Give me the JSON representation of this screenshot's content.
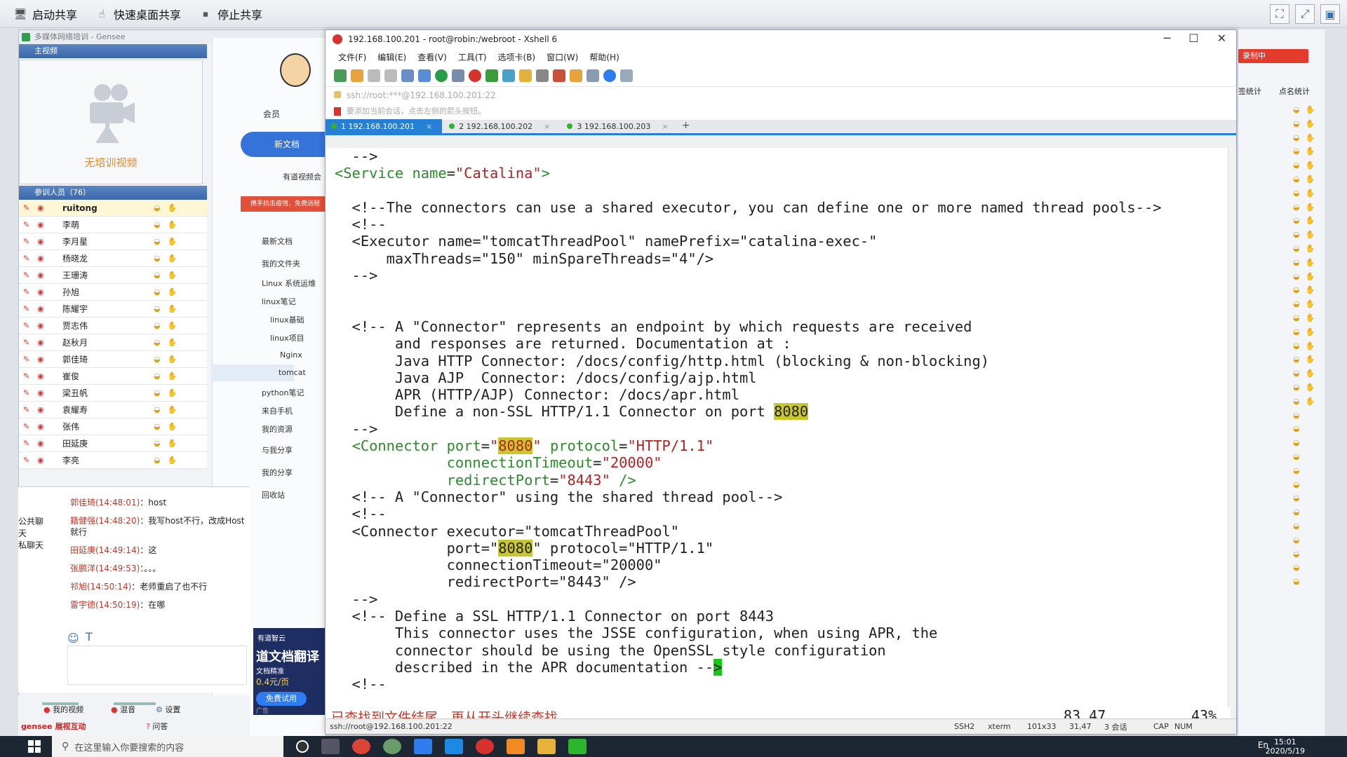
{
  "sharebar": {
    "start_share": "启动共享",
    "quick_desktop_share": "快速桌面共享",
    "stop_share": "停止共享"
  },
  "gensee": {
    "title": "多媒体网络培训 - Gensee",
    "video_panel_title": "主视频",
    "no_video_text": "无培训视频",
    "members_header": "参训人员（76）",
    "members": [
      "ruitong",
      "李萌",
      "李月星",
      "杨晓龙",
      "王珊涛",
      "孙旭",
      "陈耀宇",
      "贾志伟",
      "赵秋月",
      "郭佳琦",
      "崔俊",
      "梁丑帆",
      "袁耀寿",
      "张伟",
      "田延庚",
      "李亮"
    ],
    "chat_tabs": [
      "公共聊天",
      "私聊天"
    ],
    "chat": [
      {
        "who": "郭佳琦(14:48:01)",
        "msg": "host"
      },
      {
        "who": "籍健强(14:48:20)",
        "msg": "我写host不行，改成Host就行"
      },
      {
        "who": "田延庚(14:49:14)",
        "msg": "这"
      },
      {
        "who": "张鹏洋(14:49:53)",
        "msg": "。。。"
      },
      {
        "who": "祁旭(14:50:14)",
        "msg": "老师重启了也不行"
      },
      {
        "who": "雷宇德(14:50:19)",
        "msg": "在哪"
      }
    ],
    "bottom": {
      "my_video": "我的视频",
      "mix": "混音",
      "settings": "设置",
      "qa": "问答",
      "brand": "gensee 展视互动"
    }
  },
  "notes": {
    "member": "会员",
    "new_doc": "新文档",
    "video_meeting": "有道视频会",
    "promo": "携手抗击疫情，免费远程",
    "tree": [
      "最新文档",
      "我的文件夹",
      "Linux 系统运维",
      "linux笔记",
      "linux基础",
      "linux项目",
      "Nginx",
      "tomcat",
      "python笔记",
      "来自手机",
      "我的资源",
      "与我分享",
      "我的分享",
      "回收站"
    ],
    "ad_title": "道文档翻译",
    "ad_sub": "文档精准",
    "ad_price": "0.4元/页",
    "ad_btn": "免费试用",
    "ad_tag": "广告",
    "ad_top": "有道智云"
  },
  "xshell": {
    "title": "192.168.100.201 - root@robin:/webroot - Xshell 6",
    "menu": [
      "文件(F)",
      "编辑(E)",
      "查看(V)",
      "工具(T)",
      "选项卡(B)",
      "窗口(W)",
      "帮助(H)"
    ],
    "address": "ssh://root:***@192.168.100.201:22",
    "hint": "要添加当前会话，点击左侧的箭头按钮。",
    "tabs": [
      "1 192.168.100.201",
      "2 192.168.100.202",
      "3 192.168.100.203"
    ],
    "status_msg": "已查找到文件结尾，再从开头继续查找",
    "cursor_pos": "83,47",
    "percent": "43%",
    "statusbar": {
      "conn": "ssh://root@192.168.100.201:22",
      "proto": "SSH2",
      "term": "xterm",
      "size": "101x33",
      "pos": "31,47",
      "sessions": "3 会话",
      "cap": "CAP",
      "num": "NUM"
    }
  },
  "right_panel": {
    "stat1": "签统计",
    "stat2": "点名统计",
    "record": "录制中"
  },
  "taskbar": {
    "search_placeholder": "在这里输入你要搜索的内容",
    "time": "15:01",
    "date": "2020/5/19",
    "lang": "En"
  }
}
